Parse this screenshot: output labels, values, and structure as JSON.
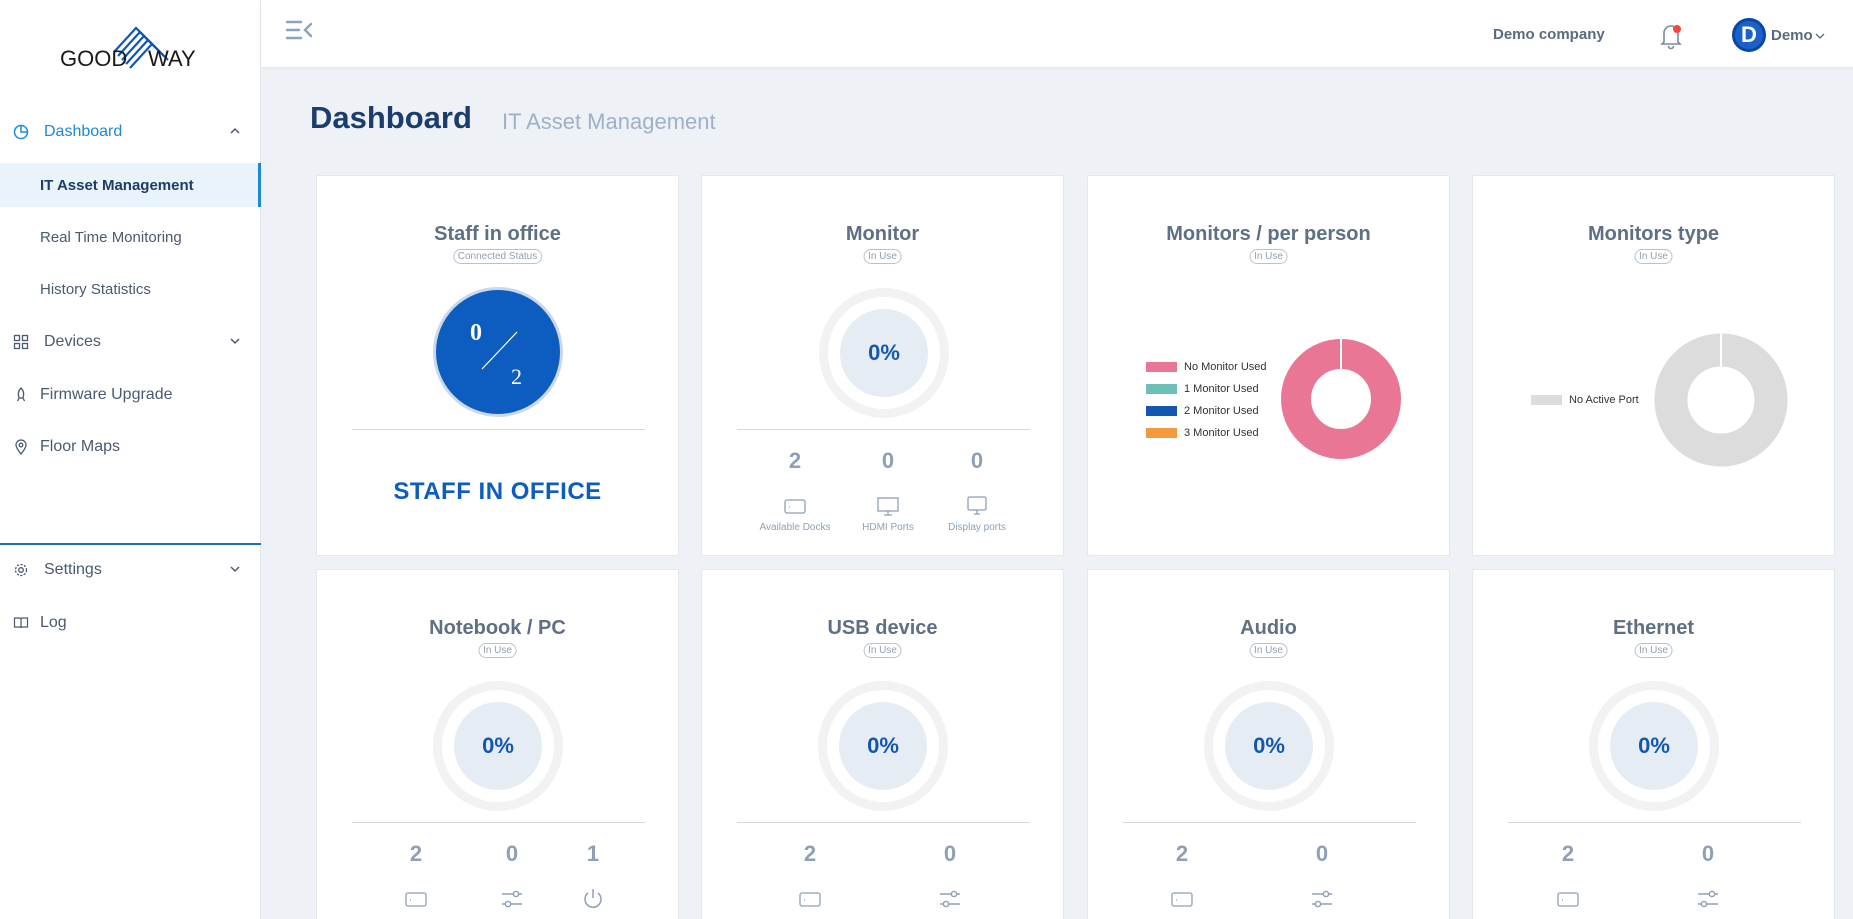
{
  "brand": {
    "logo_text": "GOODWAY"
  },
  "sidebar": {
    "dashboard": "Dashboard",
    "it_asset": "IT Asset Management",
    "realtime": "Real Time Monitoring",
    "history": "History Statistics",
    "devices": "Devices",
    "firmware": "Firmware Upgrade",
    "floormaps": "Floor Maps",
    "settings": "Settings",
    "log": "Log"
  },
  "topbar": {
    "company": "Demo company",
    "user": "Demo",
    "avatar_letter": "D"
  },
  "page": {
    "title": "Dashboard",
    "subtitle": "IT Asset Management"
  },
  "cards": {
    "staff": {
      "title": "Staff in office",
      "pill": "Connected Status",
      "count": "0",
      "total": "2",
      "big": "STAFF IN OFFICE"
    },
    "monitor": {
      "title": "Monitor",
      "pill": "In Use",
      "pct": "0%",
      "stats": [
        "2",
        "0",
        "0"
      ],
      "labels": [
        "Available Docks",
        "HDMI Ports",
        "Display ports"
      ]
    },
    "per_person": {
      "title": "Monitors / per person",
      "pill": "In Use",
      "legend": [
        "No Monitor Used",
        "1 Monitor Used",
        "2 Monitor Used",
        "3 Monitor Used"
      ]
    },
    "type": {
      "title": "Monitors type",
      "pill": "In Use",
      "legend": [
        "No Active Port"
      ]
    },
    "notebook": {
      "title": "Notebook / PC",
      "pill": "In Use",
      "pct": "0%",
      "stats": [
        "2",
        "0",
        "1"
      ]
    },
    "usb": {
      "title": "USB device",
      "pill": "In Use",
      "pct": "0%",
      "stats": [
        "2",
        "0"
      ]
    },
    "audio": {
      "title": "Audio",
      "pill": "In Use",
      "pct": "0%",
      "stats": [
        "2",
        "0"
      ]
    },
    "ethernet": {
      "title": "Ethernet",
      "pill": "In Use",
      "pct": "0%",
      "stats": [
        "2",
        "0"
      ]
    }
  },
  "colors": {
    "accent": "#1e88d9",
    "primary": "#0d5dc0",
    "pink": "#e97695",
    "teal": "#6cc0b5",
    "blue": "#1358b0",
    "orange": "#f39a3e",
    "grey": "#dcdcdc"
  }
}
